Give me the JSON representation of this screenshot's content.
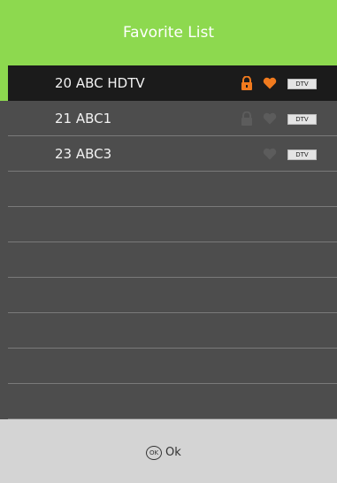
{
  "header": {
    "title": "Favorite List"
  },
  "channels": [
    {
      "label": "20 ABC HDTV",
      "badge": "DTV",
      "locked": true,
      "favorite": true,
      "selected": true
    },
    {
      "label": "21 ABC1",
      "badge": "DTV",
      "locked": true,
      "favorite": true,
      "selected": false
    },
    {
      "label": "23 ABC3",
      "badge": "DTV",
      "locked": false,
      "favorite": true,
      "selected": false
    }
  ],
  "footer": {
    "ok_icon_text": "OK",
    "ok_label": "Ok"
  },
  "colors": {
    "accent": "#8dd94f",
    "icon_active": "#f07a1e",
    "icon_inactive": "#5c5c5c"
  }
}
